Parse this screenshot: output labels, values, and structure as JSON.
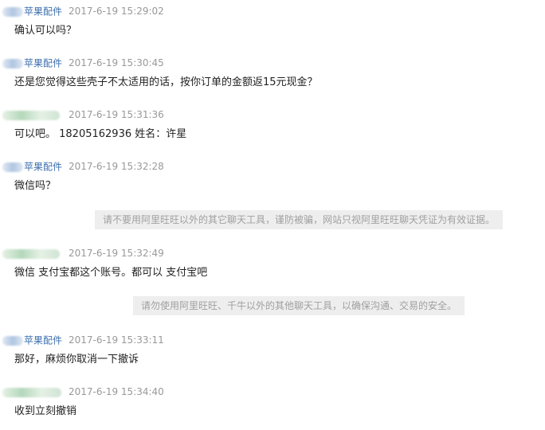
{
  "messages": [
    {
      "sender": "苹果配件",
      "time": "2017-6-19 15:29:02",
      "text": "确认可以吗？"
    },
    {
      "sender": "苹果配件",
      "time": "2017-6-19 15:30:45",
      "text": "还是您觉得这些壳子不太适用的话，按你订单的金额返15元现金？"
    },
    {
      "sender": "",
      "time": "2017-6-19 15:31:36",
      "text": "可以吧。 18205162936   姓名：许星"
    },
    {
      "sender": "苹果配件",
      "time": "2017-6-19 15:32:28",
      "text": "微信吗？"
    },
    {
      "sender": "",
      "time": "2017-6-19 15:32:49",
      "text": "微信 支付宝都这个账号。都可以 支付宝吧"
    },
    {
      "sender": "苹果配件",
      "time": "2017-6-19 15:33:11",
      "text": "那好，麻烦你取消一下撤诉"
    },
    {
      "sender": "",
      "time": "2017-6-19 15:34:40",
      "text": "收到立刻撤销"
    }
  ],
  "notices": [
    "请不要用阿里旺旺以外的其它聊天工具，谨防被骗，网站只视阿里旺旺聊天凭证为有效证据。",
    "请勿使用阿里旺旺、千牛以外的其他聊天工具，以确保沟通、交易的安全。"
  ],
  "colors": {
    "sender": "#3d6fae",
    "timestamp": "#999999",
    "text": "#222222",
    "notice_bg": "#eeeeee",
    "notice_text": "#a0a0a0"
  }
}
